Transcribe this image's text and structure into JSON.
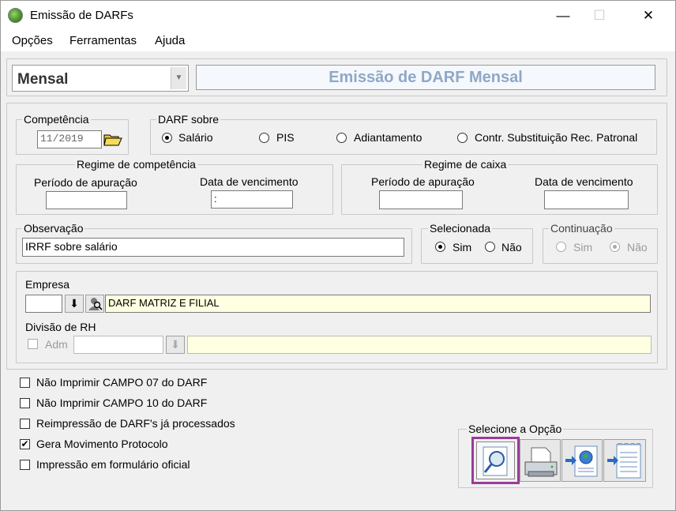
{
  "window": {
    "title": "Emissão de DARFs",
    "controls": {
      "minimize": "—",
      "maximize": "☐",
      "close": "✕"
    }
  },
  "menu": [
    "Opções",
    "Ferramentas",
    "Ajuda"
  ],
  "header": {
    "period_select": "Mensal",
    "banner": "Emissão de DARF Mensal"
  },
  "competencia": {
    "label": "Competência",
    "value": "11/2019"
  },
  "darf_sobre": {
    "label": "DARF sobre",
    "options": [
      "Salário",
      "PIS",
      "Adiantamento",
      "Contr. Substituição Rec. Patronal"
    ],
    "selected": "Salário"
  },
  "regime_competencia": {
    "label": "Regime de competência",
    "periodo_label": "Período de apuração",
    "periodo_value": "",
    "vencimento_label": "Data de vencimento",
    "vencimento_value": ":"
  },
  "regime_caixa": {
    "label": "Regime de caixa",
    "periodo_label": "Período de apuração",
    "periodo_value": "",
    "vencimento_label": "Data de vencimento",
    "vencimento_value": ""
  },
  "observacao": {
    "label": "Observação",
    "value": "IRRF sobre salário"
  },
  "selecionada": {
    "label": "Selecionada",
    "sim": "Sim",
    "nao": "Não",
    "selected": "Sim"
  },
  "continuacao": {
    "label": "Continuação",
    "sim": "Sim",
    "nao": "Não",
    "selected": "Não"
  },
  "empresa": {
    "label": "Empresa",
    "code": "",
    "name": "DARF MATRIZ E FILIAL"
  },
  "divisao": {
    "label": "Divisão de RH",
    "adm_label": "Adm",
    "code": "",
    "name": ""
  },
  "options": [
    {
      "label": "Não Imprimir CAMPO 07 do DARF",
      "checked": false
    },
    {
      "label": "Não Imprimir CAMPO 10 do DARF",
      "checked": false
    },
    {
      "label": "Reimpressão de DARF's já processados",
      "checked": false
    },
    {
      "label": "Gera Movimento Protocolo",
      "checked": true
    },
    {
      "label": "Impressão em formulário oficial",
      "checked": false
    }
  ],
  "selecione": {
    "label": "Selecione a Opção",
    "buttons": [
      "preview-icon",
      "printer-icon",
      "export-web-icon",
      "export-file-icon"
    ]
  },
  "colors": {
    "banner_text": "#8fa8c8",
    "banner_bg": "#f5f8fc",
    "highlight_field": "#ffffe1",
    "active_button_border": "#9b3a9b"
  }
}
